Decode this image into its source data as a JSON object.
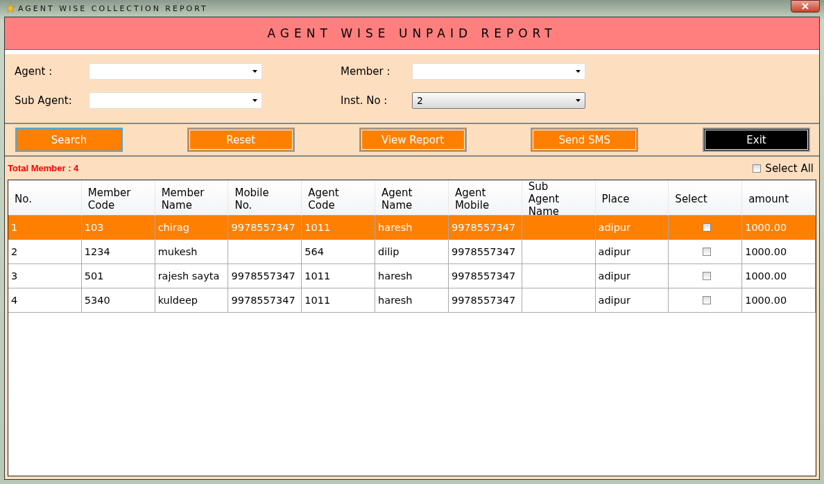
{
  "window": {
    "title": "AGENT WISE COLLECTION REPORT"
  },
  "header": {
    "title": "AGENT WISE UNPAID REPORT"
  },
  "filters": [
    {
      "label": "Agent :"
    },
    {
      "label": "Member :"
    },
    {
      "label": "Sub Agent:"
    },
    {
      "label": "Inst. No :",
      "value": "2"
    }
  ],
  "buttons": [
    {
      "label": "Search",
      "kind": "focused"
    },
    {
      "label": "Reset",
      "kind": "normal"
    },
    {
      "label": "View Report",
      "kind": "normal"
    },
    {
      "label": "Send SMS",
      "kind": "normal"
    },
    {
      "label": "Exit",
      "kind": "dark"
    }
  ],
  "total_member": "Total Member : 4",
  "select_all": {
    "label": "Select All",
    "checked": false
  },
  "table": {
    "columns": [
      "No.",
      "Member Code",
      "Member Name",
      "Mobile No.",
      "Agent Code",
      "Agent Name",
      "Agent Mobile",
      "Sub Agent Name",
      "Place",
      "Select",
      "amount"
    ],
    "rows": [
      {
        "cells": [
          "1",
          "103",
          "chirag",
          "9978557347",
          "1011",
          "haresh",
          "9978557347",
          "",
          "adipur"
        ],
        "checked": false,
        "amount": "1000.00",
        "selected": true
      },
      {
        "cells": [
          "2",
          "1234",
          "mukesh",
          "",
          "564",
          "dilip",
          "9978557347",
          "",
          "adipur"
        ],
        "checked": false,
        "amount": "1000.00",
        "selected": false
      },
      {
        "cells": [
          "3",
          "501",
          "rajesh sayta",
          "9978557347",
          "1011",
          "haresh",
          "9978557347",
          "",
          "adipur"
        ],
        "checked": false,
        "amount": "1000.00",
        "selected": false
      },
      {
        "cells": [
          "4",
          "5340",
          "kuldeep",
          "9978557347",
          "1011",
          "haresh",
          "9978557347",
          "",
          "adipur"
        ],
        "checked": false,
        "amount": "1000.00",
        "selected": false
      }
    ]
  }
}
